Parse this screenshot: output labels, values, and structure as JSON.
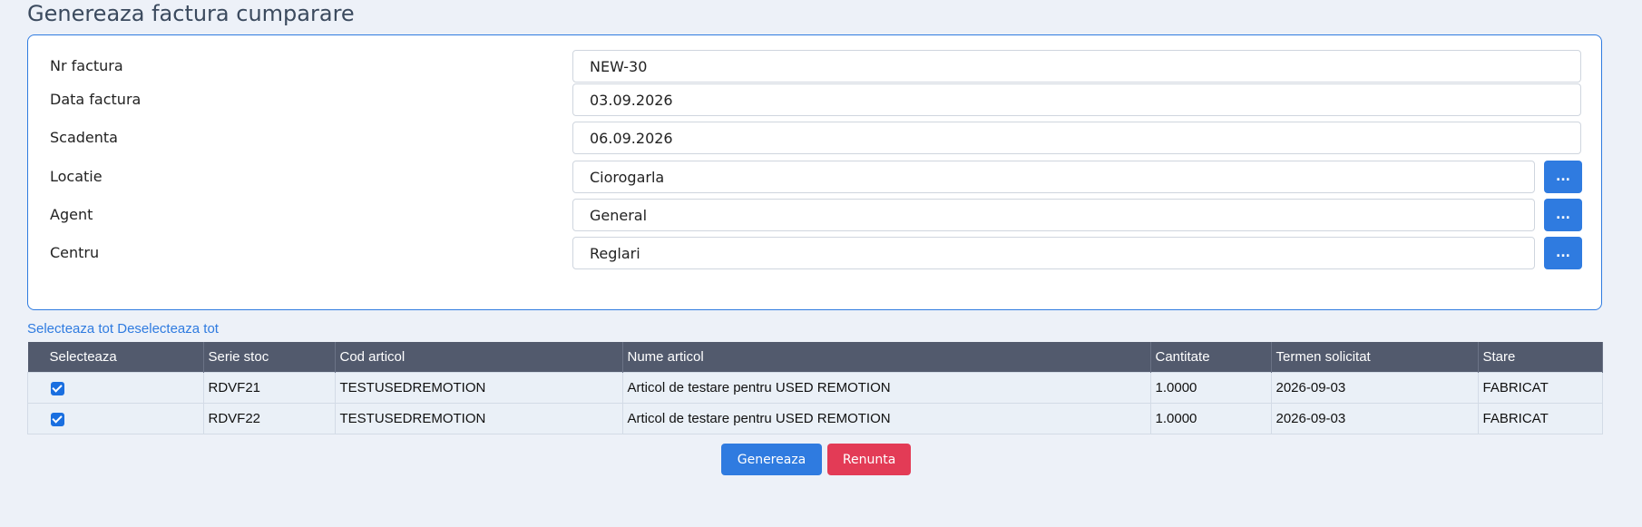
{
  "page": {
    "title": "Genereaza factura cumparare"
  },
  "form": {
    "fields": [
      {
        "label": "Nr factura",
        "value": "NEW-30"
      },
      {
        "label": "Data factura",
        "value": "03.09.2026"
      },
      {
        "label": "Scadenta",
        "value": "06.09.2026"
      },
      {
        "label": "Locatie",
        "value": "Ciorogarla",
        "button": "..."
      },
      {
        "label": "Agent",
        "value": "General",
        "button": "..."
      },
      {
        "label": "Centru",
        "value": "Reglari",
        "button": "..."
      }
    ]
  },
  "links": {
    "select_all": "Selecteaza tot",
    "deselect_all": "Deselecteaza tot"
  },
  "table": {
    "headers": [
      "Selecteaza",
      "Serie stoc",
      "Cod articol",
      "Nume articol",
      "Cantitate",
      "Termen solicitat",
      "Stare"
    ],
    "rows": [
      {
        "checked": true,
        "serie": "RDVF21",
        "cod": "TESTUSEDREMOTION",
        "nume": "Articol de testare pentru USED REMOTION",
        "cantitate": "1.0000",
        "termen": "2026-09-03",
        "stare": "FABRICAT"
      },
      {
        "checked": true,
        "serie": "RDVF22",
        "cod": "TESTUSEDREMOTION",
        "nume": "Articol de testare pentru USED REMOTION",
        "cantitate": "1.0000",
        "termen": "2026-09-03",
        "stare": "FABRICAT"
      }
    ]
  },
  "actions": {
    "generate": "Genereaza",
    "cancel": "Renunta"
  },
  "colors": {
    "accent": "#2f7be0",
    "danger": "#e33b56",
    "table_header": "#525a6d",
    "background": "#edf1f8"
  }
}
